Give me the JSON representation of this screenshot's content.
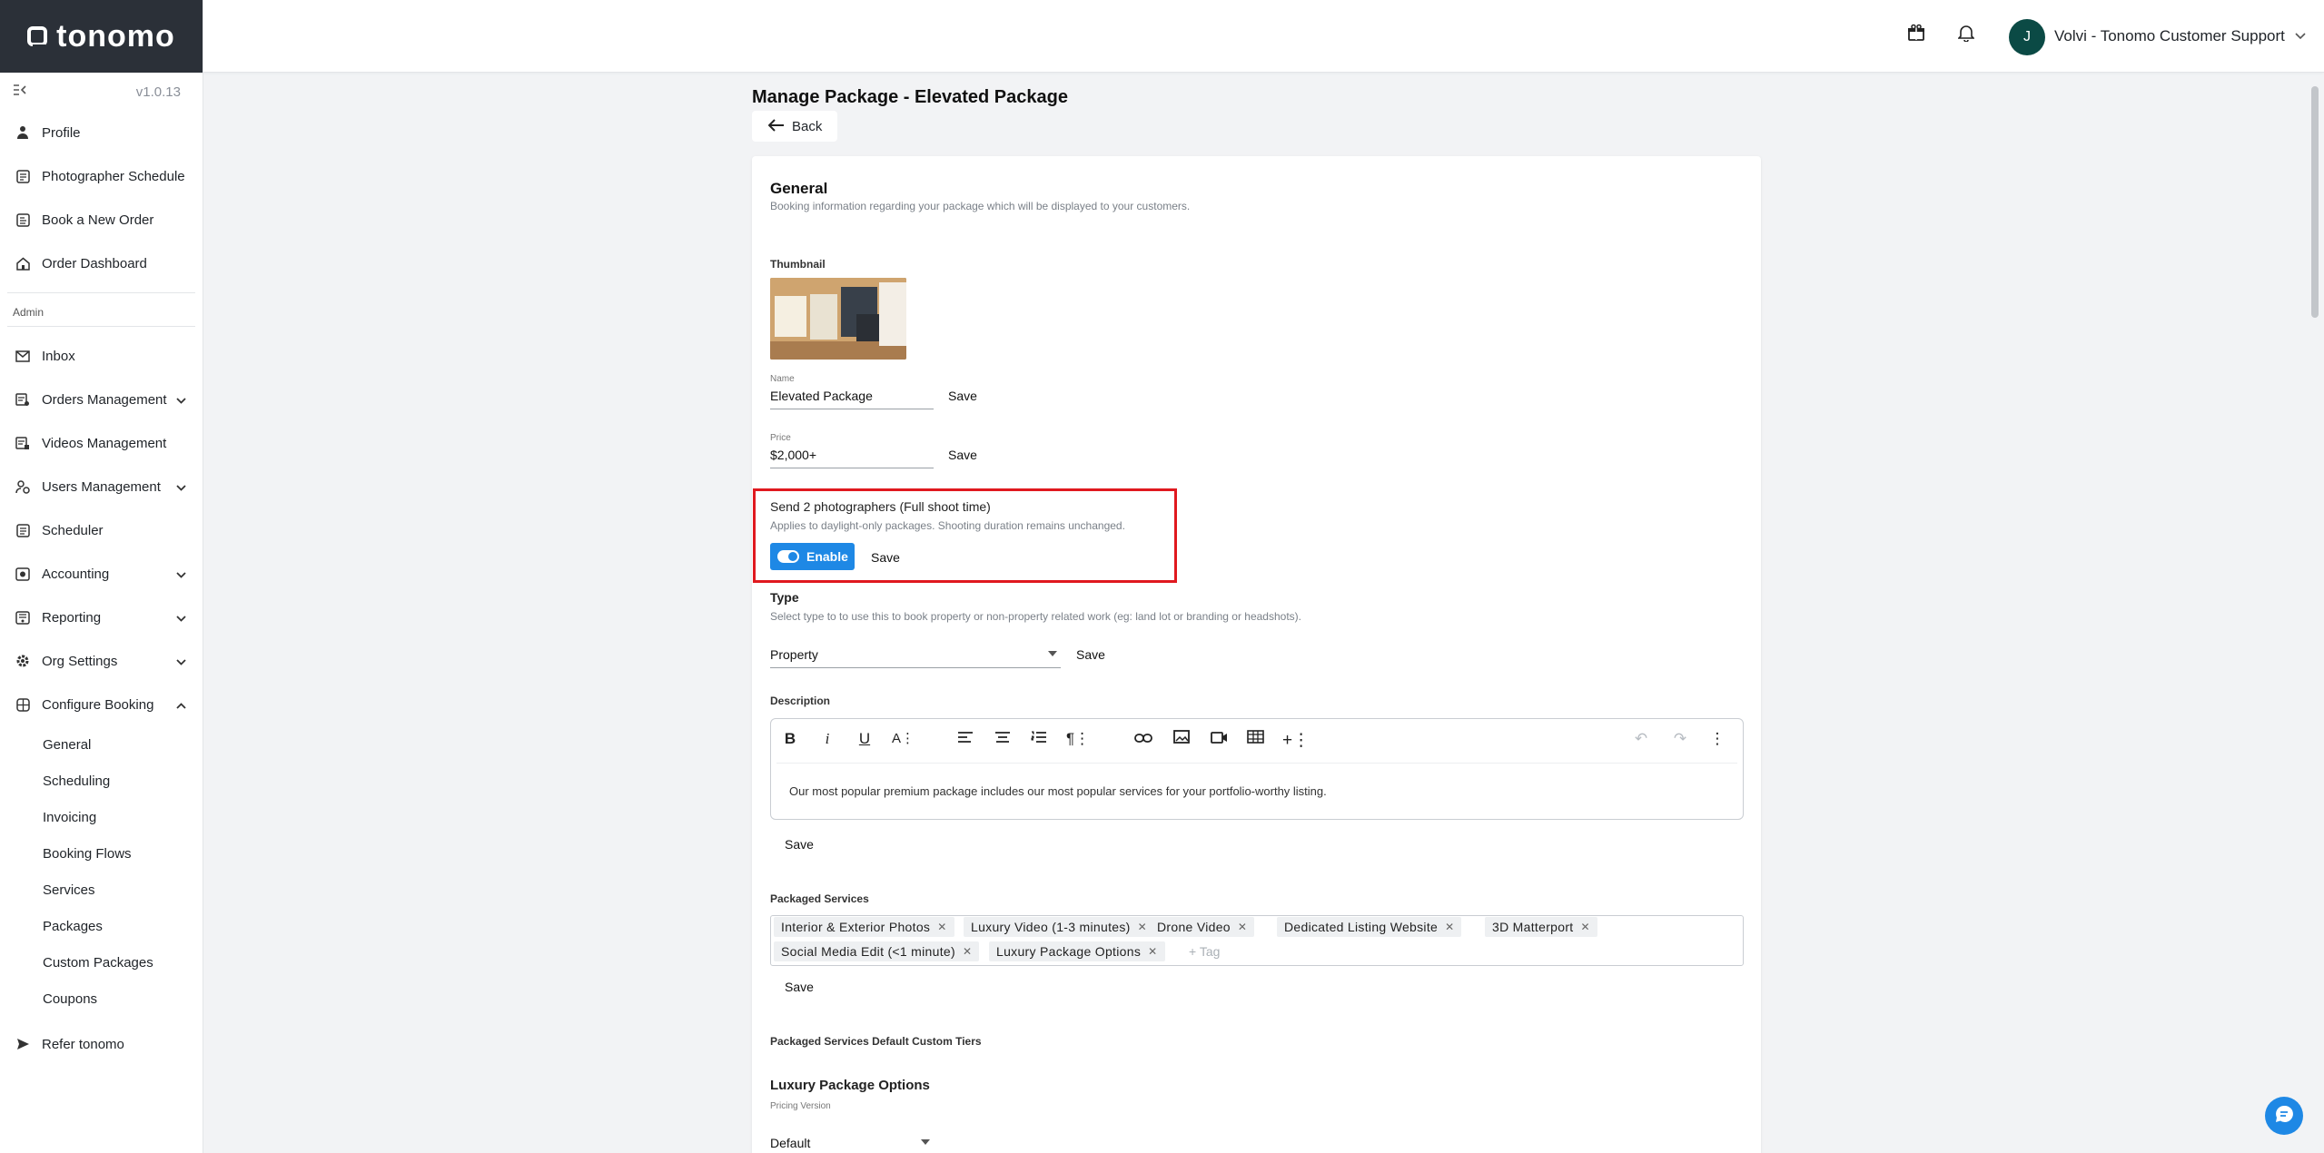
{
  "app": {
    "logo_text": "tonomo",
    "version": "v1.0.13"
  },
  "header": {
    "avatar_initial": "J",
    "user_name": "Volvi - Tonomo Customer Support"
  },
  "sidebar": {
    "top_items": [
      {
        "label": "Profile",
        "icon": "person-icon"
      },
      {
        "label": "Photographer Schedule",
        "icon": "calendar-list-icon"
      },
      {
        "label": "Book a New Order",
        "icon": "book-order-icon"
      },
      {
        "label": "Order Dashboard",
        "icon": "home-icon"
      }
    ],
    "admin_label": "Admin",
    "admin_items": [
      {
        "label": "Inbox",
        "icon": "mail-icon"
      },
      {
        "label": "Orders Management",
        "icon": "orders-icon"
      },
      {
        "label": "Videos Management",
        "icon": "video-icon"
      },
      {
        "label": "Users Management",
        "icon": "users-icon"
      },
      {
        "label": "Scheduler",
        "icon": "scheduler-icon"
      },
      {
        "label": "Accounting",
        "icon": "accounting-icon"
      },
      {
        "label": "Reporting",
        "icon": "reporting-icon"
      },
      {
        "label": "Org Settings",
        "icon": "gear-icon"
      },
      {
        "label": "Configure Booking",
        "icon": "configure-icon"
      }
    ],
    "sub_items": [
      "General",
      "Scheduling",
      "Invoicing",
      "Booking Flows",
      "Services",
      "Packages",
      "Custom Packages",
      "Coupons"
    ],
    "refer": {
      "label": "Refer tonomo",
      "icon": "send-icon"
    }
  },
  "page": {
    "title": "Manage Package - Elevated Package",
    "back_label": "Back"
  },
  "general": {
    "title": "General",
    "subtitle": "Booking information regarding your package which will be displayed to your customers.",
    "thumbnail_label": "Thumbnail",
    "name_label": "Name",
    "name_value": "Elevated Package",
    "price_label": "Price",
    "price_value": "$2,000+",
    "save_label": "Save"
  },
  "photographers": {
    "title": "Send 2 photographers (Full shoot time)",
    "subtitle": "Applies to daylight-only packages. Shooting duration remains unchanged.",
    "toggle_label": "Enable",
    "toggle_on": true,
    "save_label": "Save"
  },
  "type": {
    "title": "Type",
    "subtitle": "Select type to to use this to book property or non-property related work (eg: land lot or branding or headshots).",
    "value": "Property",
    "save_label": "Save"
  },
  "description": {
    "label": "Description",
    "text": "Our most popular premium package includes our most popular services for your portfolio-worthy listing.",
    "save_label": "Save"
  },
  "packaged_services": {
    "label": "Packaged Services",
    "tags": [
      "Interior & Exterior Photos",
      "Luxury Video (1-3 minutes)",
      "Drone Video",
      "Dedicated Listing Website",
      "3D Matterport",
      "Social Media Edit (<1 minute)",
      "Luxury Package Options"
    ],
    "add_placeholder": "+ Tag",
    "save_label": "Save"
  },
  "custom_tiers": {
    "label": "Packaged Services Default Custom Tiers",
    "group_title": "Luxury Package Options",
    "pricing_label": "Pricing Version",
    "pricing_value": "Default"
  },
  "colors": {
    "accent": "#1e88e5",
    "highlight": "#e0191f",
    "sidebar_dark": "#2b3038",
    "avatar": "#0b4a45"
  }
}
